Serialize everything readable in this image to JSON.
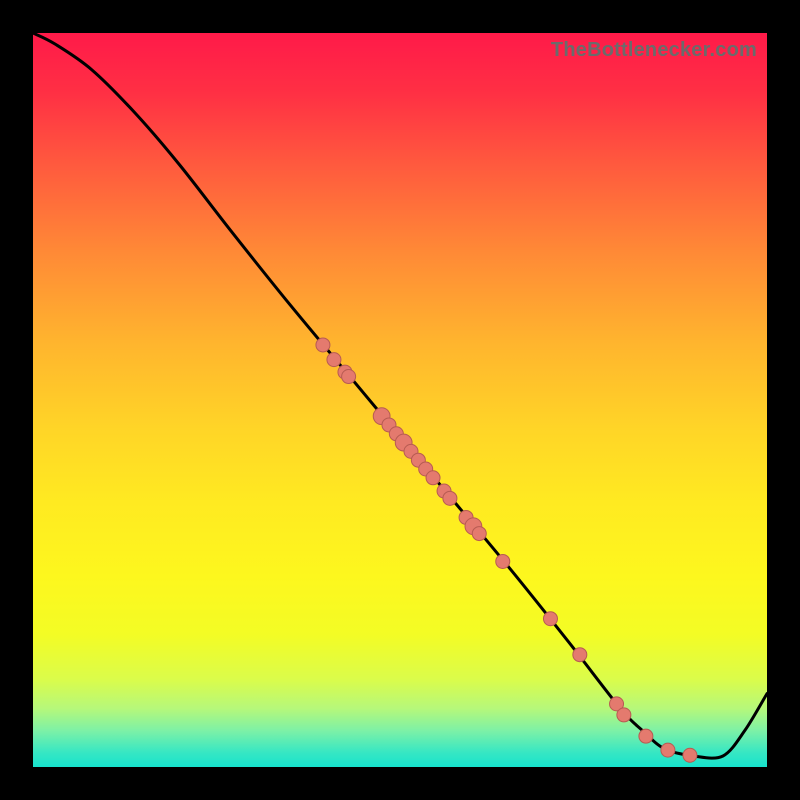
{
  "watermark": "TheBottlenecker.com",
  "colors": {
    "black": "#000000",
    "curve": "#000000",
    "dot_fill": "#e47a6e",
    "dot_stroke": "#b75b52"
  },
  "chart_data": {
    "type": "line",
    "title": "",
    "xlabel": "",
    "ylabel": "",
    "xlim": [
      0,
      100
    ],
    "ylim": [
      0,
      100
    ],
    "series": [
      {
        "name": "curve",
        "x": [
          0,
          3,
          8,
          14,
          20,
          27,
          35,
          45,
          55,
          65,
          73,
          80,
          83,
          86,
          90,
          94,
          97,
          100
        ],
        "y": [
          100,
          98.5,
          95,
          89,
          82,
          73,
          63,
          51,
          39,
          27,
          17,
          8,
          5,
          2.5,
          1.5,
          1.5,
          5,
          10
        ]
      }
    ],
    "points": [
      {
        "x": 39.5,
        "y": 57.5,
        "r": 1.0
      },
      {
        "x": 41.0,
        "y": 55.5,
        "r": 1.0
      },
      {
        "x": 42.5,
        "y": 53.8,
        "r": 1.0
      },
      {
        "x": 43.0,
        "y": 53.2,
        "r": 1.0
      },
      {
        "x": 47.5,
        "y": 47.8,
        "r": 1.2
      },
      {
        "x": 48.5,
        "y": 46.6,
        "r": 1.0
      },
      {
        "x": 49.5,
        "y": 45.4,
        "r": 1.0
      },
      {
        "x": 50.5,
        "y": 44.2,
        "r": 1.2
      },
      {
        "x": 51.5,
        "y": 43.0,
        "r": 1.0
      },
      {
        "x": 52.5,
        "y": 41.8,
        "r": 1.0
      },
      {
        "x": 53.5,
        "y": 40.6,
        "r": 1.0
      },
      {
        "x": 54.5,
        "y": 39.4,
        "r": 1.0
      },
      {
        "x": 56.0,
        "y": 37.6,
        "r": 1.0
      },
      {
        "x": 56.8,
        "y": 36.6,
        "r": 1.0
      },
      {
        "x": 59.0,
        "y": 34.0,
        "r": 1.0
      },
      {
        "x": 60.0,
        "y": 32.8,
        "r": 1.2
      },
      {
        "x": 60.8,
        "y": 31.8,
        "r": 1.0
      },
      {
        "x": 64.0,
        "y": 28.0,
        "r": 1.0
      },
      {
        "x": 70.5,
        "y": 20.2,
        "r": 1.0
      },
      {
        "x": 74.5,
        "y": 15.3,
        "r": 1.0
      },
      {
        "x": 79.5,
        "y": 8.6,
        "r": 1.0
      },
      {
        "x": 80.5,
        "y": 7.1,
        "r": 1.0
      },
      {
        "x": 83.5,
        "y": 4.2,
        "r": 1.0
      },
      {
        "x": 86.5,
        "y": 2.3,
        "r": 1.0
      },
      {
        "x": 89.5,
        "y": 1.6,
        "r": 1.0
      }
    ]
  }
}
